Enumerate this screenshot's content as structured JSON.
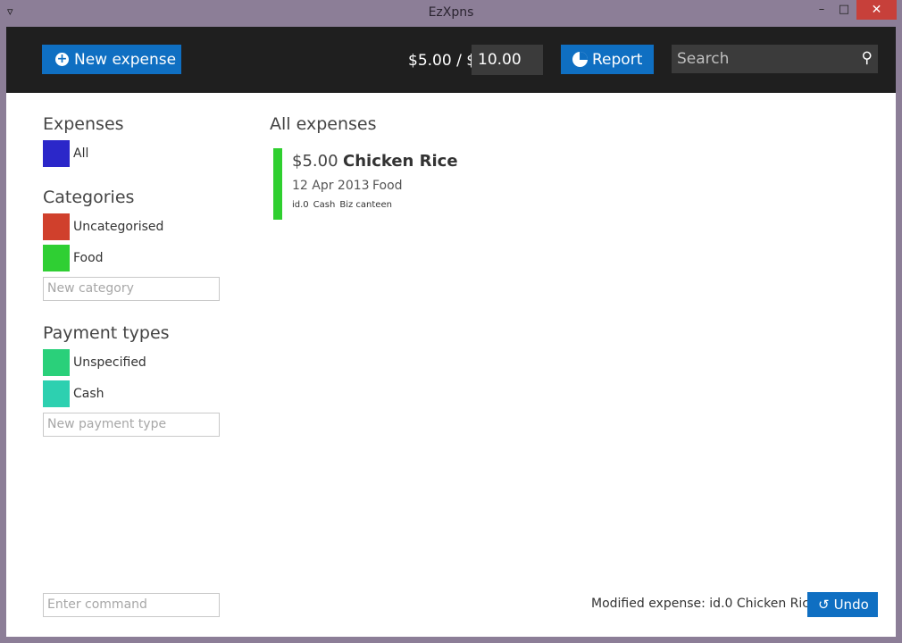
{
  "window": {
    "title": "EzXpns",
    "minimize_glyph": "–",
    "maximize_glyph": "□",
    "close_glyph": "✕",
    "app_icon": "wallet-icon"
  },
  "toolbar": {
    "new_expense_label": "New expense",
    "budget_spent": "$5.00 / $",
    "budget_limit": "10.00",
    "report_label": "Report",
    "search_placeholder": "Search"
  },
  "sidebar": {
    "expenses_title": "Expenses",
    "expenses_items": [
      {
        "label": "All",
        "color": "#2b27c9"
      }
    ],
    "categories_title": "Categories",
    "categories_items": [
      {
        "label": "Uncategorised",
        "color": "#d0402c"
      },
      {
        "label": "Food",
        "color": "#2fcf33"
      }
    ],
    "new_category_placeholder": "New category",
    "payment_title": "Payment types",
    "payment_items": [
      {
        "label": "Unspecified",
        "color": "#2ad07a"
      },
      {
        "label": "Cash",
        "color": "#2dd0b0"
      }
    ],
    "new_payment_placeholder": "New payment type",
    "command_placeholder": "Enter command"
  },
  "main": {
    "title": "All expenses",
    "expenses": [
      {
        "amount": "$5.00",
        "name": "Chicken Rice",
        "date": "12 Apr 2013",
        "category": "Food",
        "tags": [
          "id.0",
          "Cash",
          "Biz canteen"
        ],
        "color": "#2fcf2f"
      }
    ]
  },
  "status": {
    "message": "Modified expense: id.0 Chicken Rice",
    "undo_label": "Undo"
  },
  "colors": {
    "accent": "#0f6fc2",
    "header_bg": "#1f1f1f",
    "close": "#c7403a"
  }
}
